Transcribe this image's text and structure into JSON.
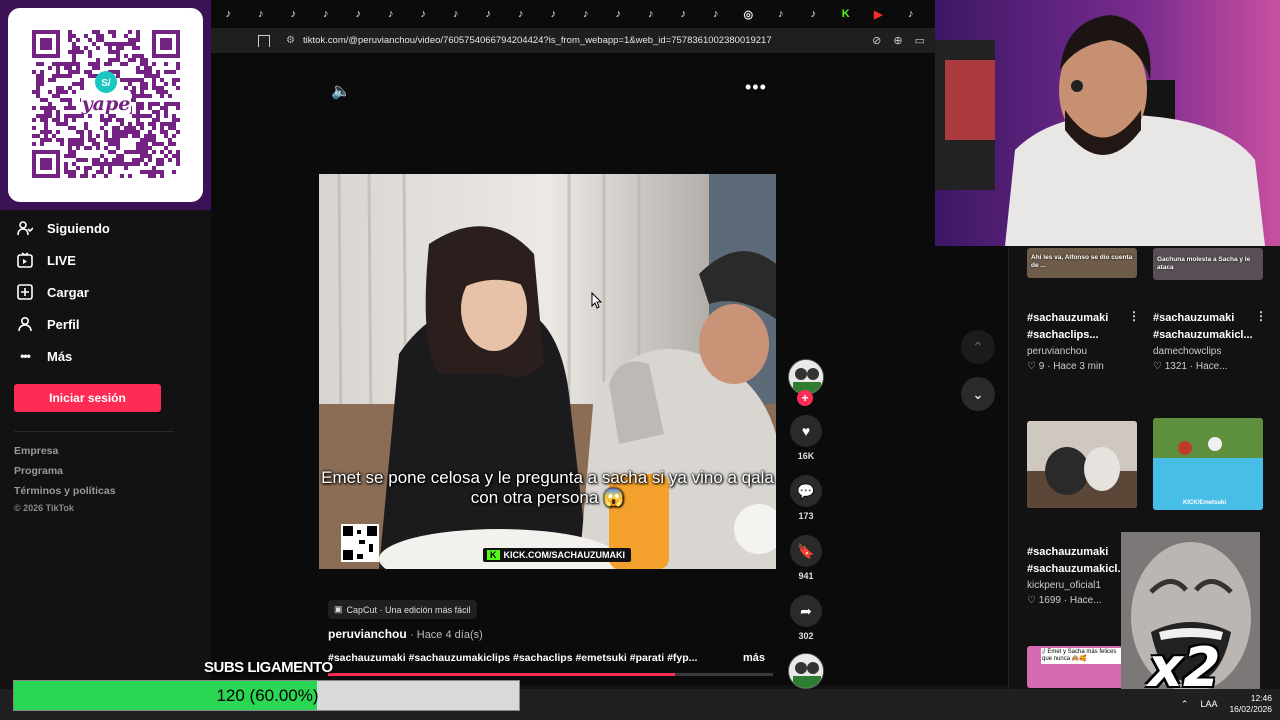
{
  "browser": {
    "url": "tiktok.com/@peruvianchou/video/7605754066794204424?is_from_webapp=1&web_id=7578361002380019217",
    "tabs": [
      "♪",
      "♪",
      "♪",
      "♪",
      "♪",
      "♪",
      "♪",
      "♪",
      "♪",
      "♪",
      "♪",
      "♪",
      "♪",
      "♪",
      "♪",
      "♪",
      "◎",
      "♪",
      "♪",
      "K",
      "▶",
      "♪"
    ]
  },
  "qr": {
    "brand": "yape",
    "symbol": "S/"
  },
  "sidebar": {
    "items": [
      {
        "label": "Siguiendo",
        "icon": "following-icon"
      },
      {
        "label": "LIVE",
        "icon": "live-icon"
      },
      {
        "label": "Cargar",
        "icon": "upload-icon"
      },
      {
        "label": "Perfil",
        "icon": "profile-icon"
      },
      {
        "label": "Más",
        "icon": "more-icon"
      }
    ],
    "login_label": "Iniciar sesión",
    "footer": [
      "Empresa",
      "Programa",
      "Términos y políticas",
      "© 2026 TikTok"
    ]
  },
  "video": {
    "caption": "Emet se pone celosa y le pregunta a sacha si ya vino a qala con otra persona 😱",
    "kick_badge": "KICK.COM/SACHAUZUMAKI",
    "capcut": "CapCut · Una edición más fácil",
    "author": "peruvianchou",
    "time": "· Hace 4 día(s)",
    "tags": "#sachauzumaki #sachauzumakiclips #sachaclips #emetsuki  #parati #fyp...",
    "more_label": "más",
    "progress": 0.78,
    "likes": "16K",
    "comments": "173",
    "saves": "941",
    "shares": "302"
  },
  "related": [
    {
      "title1": "#sachauzumaki",
      "title2": "#sachaclips...",
      "author": "peruvianchou",
      "likes": "9",
      "time": "Hace 3 min"
    },
    {
      "title1": "#sachauzumaki",
      "title2": "#sachauzumakicl...",
      "author": "damechowclips",
      "likes": "1321",
      "time": "Hace..."
    },
    {
      "title1": "#sachauzumaki",
      "title2": "#sachauzumakicl...",
      "author": "kickperu_oficial1",
      "likes": "1699",
      "time": "Hace..."
    }
  ],
  "thumb_texts": {
    "top_left": "Ahí les va, Alfonso se dio cuenta de ...",
    "top_right": "Gachuna molesta a Sacha y le ataca",
    "mid_right": "KICK/Emetsuki",
    "bottom_left": "¡! Emet y Sacha más felices que nunca 🙈🥰"
  },
  "overlay": {
    "subs_label": "SUBS LIGAMENTO",
    "subs_text": "120 (60.00%)",
    "subs_fraction": 0.6,
    "emote_multiplier": "x2"
  },
  "taskbar": {
    "lang": "LAA",
    "time": "12:46",
    "date": "16/02/2026"
  },
  "colors": {
    "accent": "#fe2c55",
    "subs_fill": "#2bd654",
    "kick_green": "#53fc18"
  }
}
